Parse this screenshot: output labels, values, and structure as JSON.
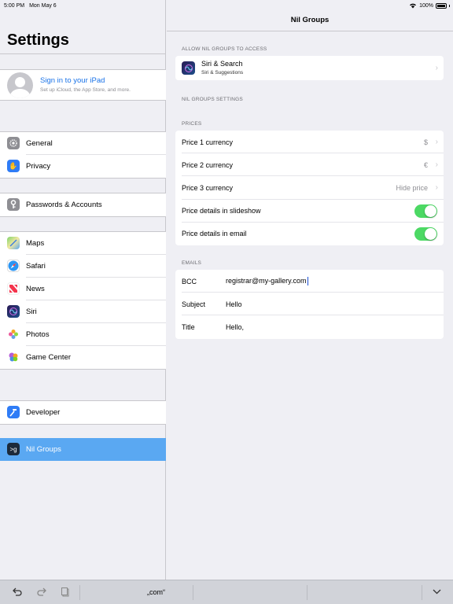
{
  "status": {
    "time": "5:00 PM",
    "date": "Mon May 6",
    "battery": "100%"
  },
  "sidebar": {
    "title": "Settings",
    "profile": {
      "title": "Sign in to your iPad",
      "subtitle": "Set up iCloud, the App Store, and more."
    },
    "groups": [
      [
        {
          "label": "General",
          "icon": "gear-icon",
          "color": "#8e8e93"
        },
        {
          "label": "Privacy",
          "icon": "hand-icon",
          "color": "#2f7cf6"
        }
      ],
      [
        {
          "label": "Passwords & Accounts",
          "icon": "key-icon",
          "color": "#8e8e93"
        }
      ],
      [
        {
          "label": "Maps",
          "icon": "maps-icon",
          "color": "#5ec05a"
        },
        {
          "label": "Safari",
          "icon": "compass-icon",
          "color": "#2a95f3"
        },
        {
          "label": "News",
          "icon": "news-icon",
          "color": "#f4344c"
        },
        {
          "label": "Siri",
          "icon": "siri-icon",
          "color": "#2b1a55"
        },
        {
          "label": "Photos",
          "icon": "photos-icon",
          "color": "#f0a030"
        },
        {
          "label": "Game Center",
          "icon": "game-center-icon",
          "color": "#b45bd9"
        }
      ],
      [
        {
          "label": "Developer",
          "icon": "hammer-icon",
          "color": "#2f7cf6"
        }
      ],
      [
        {
          "label": "Nil Groups",
          "icon": "nil-groups-icon",
          "color": "#1c2a3a",
          "selected": true
        }
      ]
    ]
  },
  "main": {
    "title": "Nil Groups",
    "access_header": "ALLOW NIL GROUPS TO ACCESS",
    "siri_row": {
      "title": "Siri & Search",
      "subtitle": "Siri & Suggestions"
    },
    "settings_header": "NIL GROUPS SETTINGS",
    "prices_header": "PRICES",
    "prices": [
      {
        "label": "Price 1 currency",
        "value": "$"
      },
      {
        "label": "Price 2 currency",
        "value": "€"
      },
      {
        "label": "Price 3 currency",
        "value": "Hide price"
      }
    ],
    "toggles": [
      {
        "label": "Price details in slideshow",
        "on": true
      },
      {
        "label": "Price details in email",
        "on": true
      }
    ],
    "emails_header": "EMAILS",
    "emails": [
      {
        "label": "BCC",
        "value": "registrar@my-gallery.com"
      },
      {
        "label": "Subject",
        "value": "Hello"
      },
      {
        "label": "Title",
        "value": "Hello,"
      }
    ]
  },
  "keyboard": {
    "suggestion": "„com“"
  }
}
